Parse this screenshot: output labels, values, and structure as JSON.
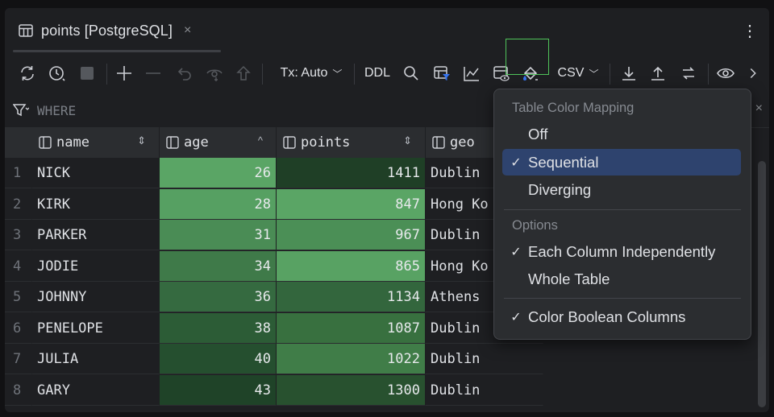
{
  "tab": {
    "title": "points [PostgreSQL]",
    "close": "×",
    "more": "⋮"
  },
  "toolbar": {
    "tx_label": "Tx: Auto",
    "ddl_label": "DDL",
    "csv_label": "CSV"
  },
  "filter": {
    "placeholder": "WHERE",
    "close": "×"
  },
  "columns": [
    {
      "name": "name",
      "sort": "⇕"
    },
    {
      "name": "age",
      "sort": "^"
    },
    {
      "name": "points",
      "sort": "⇕"
    },
    {
      "name": "geo",
      "sort": ""
    }
  ],
  "rows": [
    {
      "n": "1",
      "name": "NICK",
      "age": "26",
      "points": "1411",
      "geo": "Dublin"
    },
    {
      "n": "2",
      "name": "KIRK",
      "age": "28",
      "points": "847",
      "geo": "Hong Ko"
    },
    {
      "n": "3",
      "name": "PARKER",
      "age": "31",
      "points": "967",
      "geo": "Dublin"
    },
    {
      "n": "4",
      "name": "JODIE",
      "age": "34",
      "points": "865",
      "geo": "Hong Ko"
    },
    {
      "n": "5",
      "name": "JOHNNY",
      "age": "36",
      "points": "1134",
      "geo": "Athens"
    },
    {
      "n": "6",
      "name": "PENELOPE",
      "age": "38",
      "points": "1087",
      "geo": "Dublin"
    },
    {
      "n": "7",
      "name": "JULIA",
      "age": "40",
      "points": "1022",
      "geo": "Dublin"
    },
    {
      "n": "8",
      "name": "GARY",
      "age": "43",
      "points": "1300",
      "geo": "Dublin"
    }
  ],
  "heat_colors": {
    "age": [
      "#5aa565",
      "#56a062",
      "#4a8c55",
      "#3f7a49",
      "#356a40",
      "#2c5c36",
      "#254f2f",
      "#1f4328"
    ],
    "points": [
      "#1f3f26",
      "#5aa565",
      "#4b8f56",
      "#58a263",
      "#33663d",
      "#38703f",
      "#407d48",
      "#28512f"
    ]
  },
  "menu": {
    "section1": "Table Color Mapping",
    "off": "Off",
    "sequential": "Sequential",
    "diverging": "Diverging",
    "section2": "Options",
    "each_column": "Each Column Independently",
    "whole_table": "Whole Table",
    "color_boolean": "Color Boolean Columns",
    "check": "✓"
  },
  "colors": {
    "accent_selected": "#2e436e",
    "highlight": "#4fc35a"
  }
}
